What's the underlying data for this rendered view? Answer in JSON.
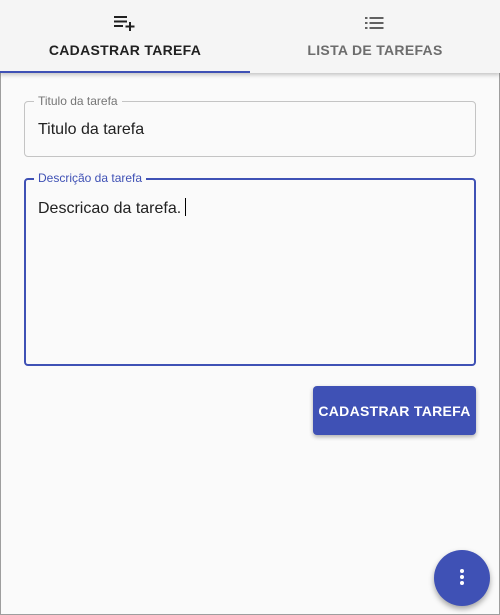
{
  "tabs": [
    {
      "label": "CADASTRAR TAREFA",
      "icon": "playlist-add-icon",
      "active": true
    },
    {
      "label": "LISTA DE TAREFAS",
      "icon": "list-icon",
      "active": false
    }
  ],
  "form": {
    "title_field": {
      "label": "Titulo da tarefa",
      "value": "Titulo da tarefa"
    },
    "description_field": {
      "label": "Descrição da tarefa",
      "value": "Descricao da tarefa."
    },
    "submit_label": "CADASTRAR TAREFA"
  },
  "fab": {
    "icon": "more-vertical-icon"
  },
  "colors": {
    "primary": "#3f51b5",
    "background": "#fafafa",
    "tabbar_background": "#f5f5f5"
  }
}
